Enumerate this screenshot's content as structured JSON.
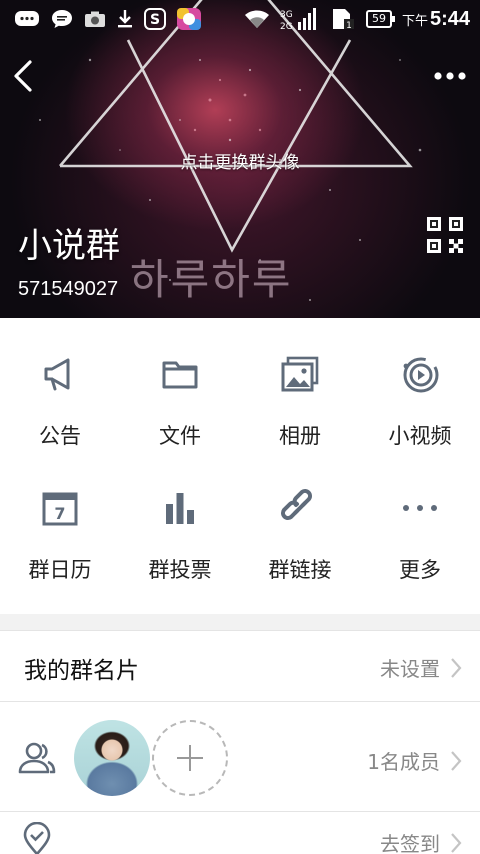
{
  "status_bar": {
    "time": "5:44",
    "ampm": "下午",
    "battery": "59",
    "network": "3G\n2G"
  },
  "header": {
    "change_avatar_hint": "点击更换群头像",
    "group_name": "小说群",
    "group_id": "571549027",
    "cover_text": "하루하루"
  },
  "grid": {
    "row1": [
      {
        "label": "公告",
        "icon": "megaphone-icon"
      },
      {
        "label": "文件",
        "icon": "folder-icon"
      },
      {
        "label": "相册",
        "icon": "album-icon"
      },
      {
        "label": "小视频",
        "icon": "video-icon"
      }
    ],
    "row2": [
      {
        "label": "群日历",
        "icon": "calendar-icon",
        "calendar_day": "7"
      },
      {
        "label": "群投票",
        "icon": "vote-chart-icon"
      },
      {
        "label": "群链接",
        "icon": "link-icon"
      },
      {
        "label": "更多",
        "icon": "more-dots-icon"
      }
    ]
  },
  "my_card": {
    "title": "我的群名片",
    "value": "未设置"
  },
  "members": {
    "count_label": "1名成员"
  },
  "checkin": {
    "label": "去签到"
  },
  "colors": {
    "icon_gray": "#5f6b7a",
    "text_dark": "#222222",
    "text_muted": "#888888",
    "background": "#f2f2f2"
  }
}
